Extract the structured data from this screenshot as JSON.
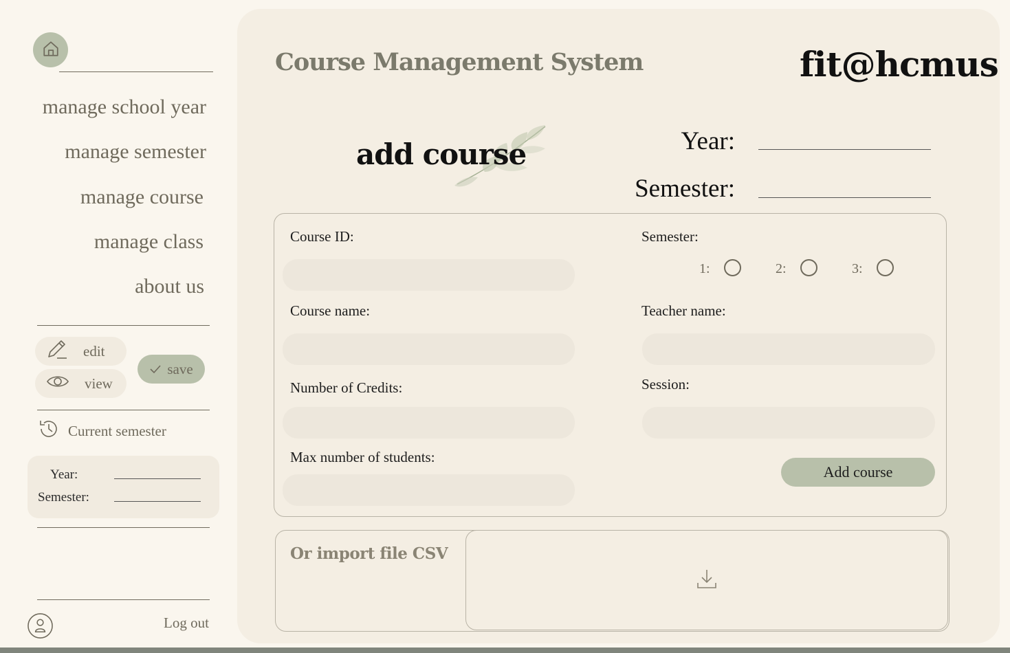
{
  "sidebar": {
    "home_icon": "home-icon",
    "nav": [
      {
        "label": "manage school year"
      },
      {
        "label": "manage semester"
      },
      {
        "label": "manage course"
      },
      {
        "label": "manage class"
      },
      {
        "label": "about us"
      }
    ],
    "edit_label": "edit",
    "view_label": "view",
    "save_label": "save",
    "current_semester_label": "Current semester",
    "current": {
      "year_label": "Year:",
      "year_value": "",
      "semester_label": "Semester:",
      "semester_value": ""
    },
    "logout_label": "Log out"
  },
  "header": {
    "app_title": "Course Management System",
    "brand": "fit@hcmus",
    "page_heading": "add course",
    "year_label": "Year:",
    "year_value": "",
    "semester_label": "Semester:",
    "semester_value": ""
  },
  "form": {
    "course_id_label": "Course ID:",
    "course_id_value": "",
    "course_name_label": "Course name:",
    "course_name_value": "",
    "credits_label": "Number of Credits:",
    "credits_value": "",
    "max_students_label": "Max number of students:",
    "max_students_value": "",
    "semester_label": "Semester:",
    "semester_options": [
      "1:",
      "2:",
      "3:"
    ],
    "teacher_label": "Teacher name:",
    "teacher_value": "",
    "session_label": "Session:",
    "session_value": "",
    "add_button": "Add course"
  },
  "import": {
    "label": "Or import file CSV",
    "icon": "download-icon"
  },
  "colors": {
    "accent": "#b8c0aa",
    "panel": "#f4eee3",
    "background": "#faf6ee",
    "input": "#ede7dc",
    "text_muted": "#6f6a5c"
  }
}
